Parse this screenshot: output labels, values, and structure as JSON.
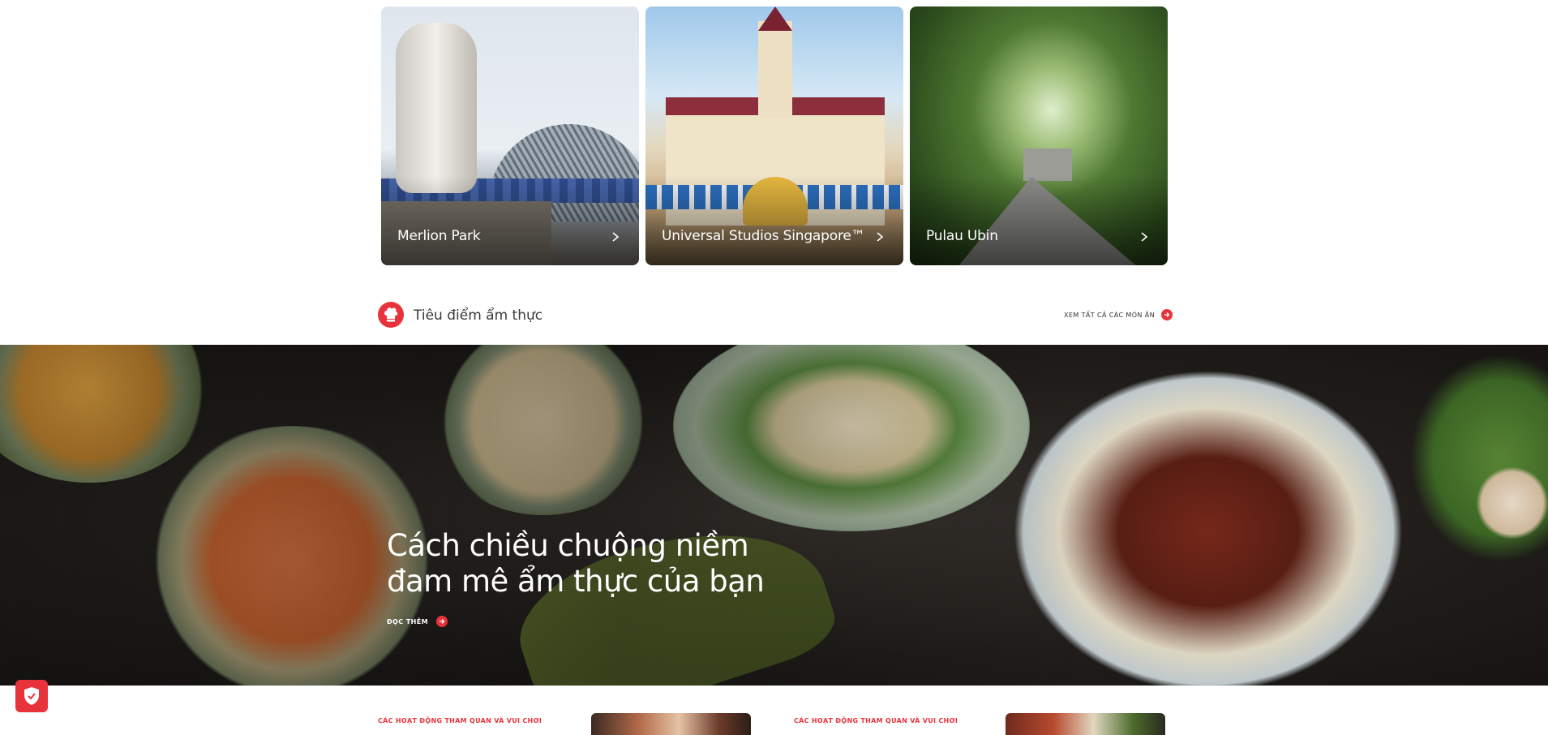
{
  "attractions": [
    {
      "name": "Merlion Park",
      "icon": "chevron-right-icon"
    },
    {
      "name": "Universal Studios Singapore™",
      "icon": "chevron-right-icon"
    },
    {
      "name": "Pulau Ubin",
      "icon": "chevron-right-icon"
    }
  ],
  "food_section": {
    "icon": "chef-hat-icon",
    "title": "Tiêu điểm ẩm thực",
    "see_all_label": "XEM TẤT CẢ CÁC MÓN ĂN",
    "see_all_icon": "arrow-right-circle-icon"
  },
  "hero": {
    "title": "Cách chiều chuộng niềm đam mê ẩm thực của bạn",
    "read_more_label": "ĐỌC THÊM",
    "read_more_icon": "arrow-right-circle-icon"
  },
  "bottom_cards": [
    {
      "category": "CÁC HOẠT ĐỘNG THAM QUAN VÀ VUI CHƠI"
    },
    {
      "category": "CÁC HOẠT ĐỘNG THAM QUAN VÀ VUI CHƠI"
    }
  ],
  "privacy_badge": {
    "icon": "shield-check-icon"
  },
  "colors": {
    "accent": "#e8333b",
    "text_dark": "#3a3a3a",
    "white": "#ffffff"
  }
}
